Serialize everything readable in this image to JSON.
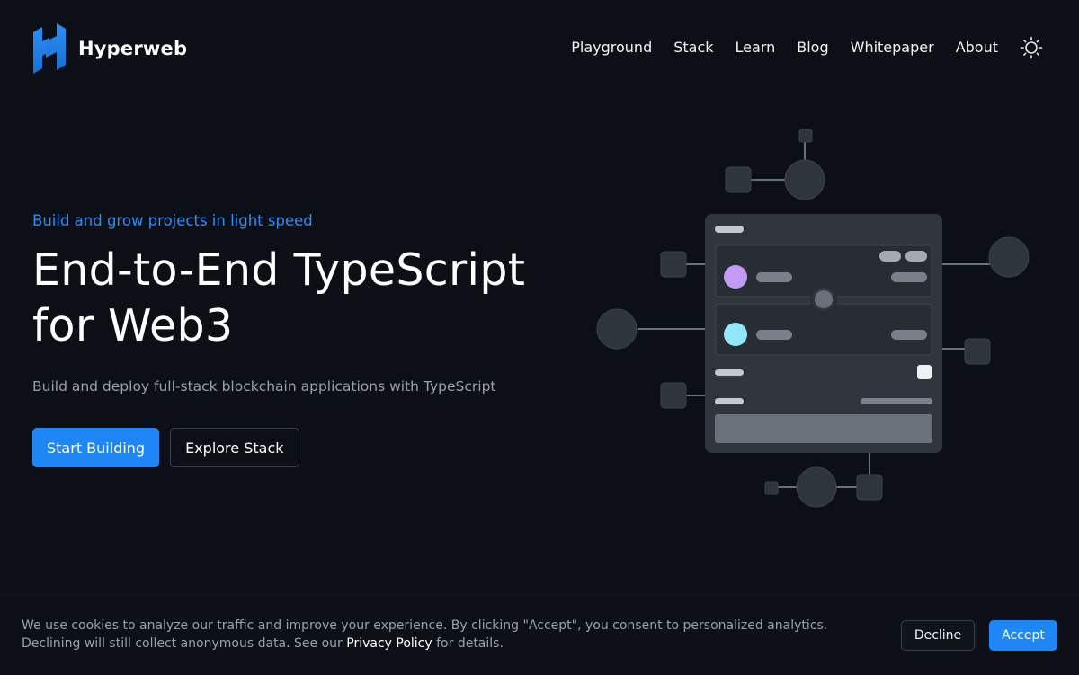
{
  "brand": {
    "name": "Hyperweb",
    "logo_icon": "hyperweb-logo-icon",
    "accent_color": "#1f87f5"
  },
  "nav": {
    "items": [
      "Playground",
      "Stack",
      "Learn",
      "Blog",
      "Whitepaper",
      "About"
    ],
    "theme_toggle_icon": "sun-icon"
  },
  "hero": {
    "eyebrow": "Build and grow projects in light speed",
    "title_line1": "End-to-End TypeScript",
    "title_line2": "for Web3",
    "subtitle": "Build and deploy full-stack blockchain applications with TypeScript",
    "primary_cta": "Start Building",
    "secondary_cta": "Explore Stack"
  },
  "cookie_banner": {
    "text_before_link": "We use cookies to analyze our traffic and improve your experience. By clicking \"Accept\", you consent to personalized analytics. Declining will still collect anonymous data. See our ",
    "link_text": "Privacy Policy",
    "text_after_link": " for details.",
    "decline_label": "Decline",
    "accept_label": "Accept"
  }
}
